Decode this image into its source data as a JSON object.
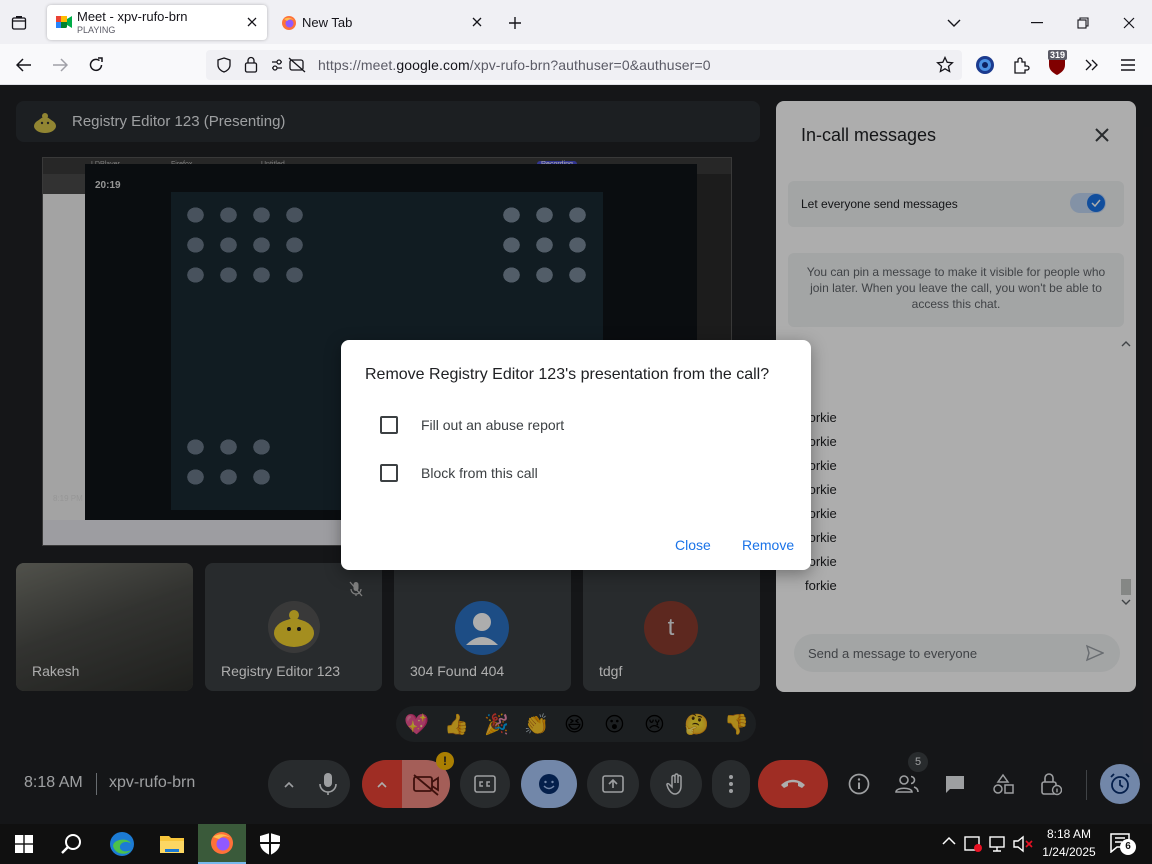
{
  "browser": {
    "tabs": [
      {
        "title": "Meet - xpv-rufo-brn",
        "subtitle": "PLAYING"
      },
      {
        "title": "New Tab"
      }
    ],
    "url_prefix": "https://meet.",
    "url_domain": "google.com",
    "url_path": "/xpv-rufo-brn?authuser=0&authuser=0",
    "badge_count": "319"
  },
  "meet": {
    "presenting_label": "Registry Editor 123 (Presenting)",
    "shared_screen": {
      "time_top": "20:19",
      "time_bottom": "8:19 PM",
      "tabs": [
        "LDPlayer",
        "Firefox",
        "Untitled",
        "Recording"
      ]
    },
    "participants": [
      {
        "name": "Rakesh"
      },
      {
        "name": "Registry Editor 123"
      },
      {
        "name": "304 Found 404"
      },
      {
        "name": "tdgf",
        "initial": "t"
      }
    ],
    "reactions": [
      "💖",
      "👍",
      "🎉",
      "👏",
      "😆",
      "😮",
      "😢",
      "🤔",
      "👎"
    ],
    "bottom": {
      "time": "8:18 AM",
      "meeting_code": "xpv-rufo-brn",
      "people_count": "5"
    }
  },
  "chat_panel": {
    "title": "In-call messages",
    "toggle_label": "Let everyone send messages",
    "info_text": "You can pin a message to make it visible for people who join later. When you leave the call, you won't be able to access this chat.",
    "messages": [
      "forkie",
      "forkie",
      "forkie",
      "forkie",
      "forkie",
      "forkie",
      "forkie",
      "forkie"
    ],
    "input_placeholder": "Send a message to everyone"
  },
  "dialog": {
    "title": "Remove Registry Editor 123's presentation from the call?",
    "option1": "Fill out an abuse report",
    "option2": "Block from this call",
    "close_label": "Close",
    "remove_label": "Remove"
  },
  "taskbar": {
    "time": "8:18 AM",
    "date": "1/24/2025",
    "notification_count": "6"
  },
  "colors": {
    "accent_blue": "#1a73e8",
    "end_call_red": "#ea4335",
    "meet_background": "#202124"
  }
}
